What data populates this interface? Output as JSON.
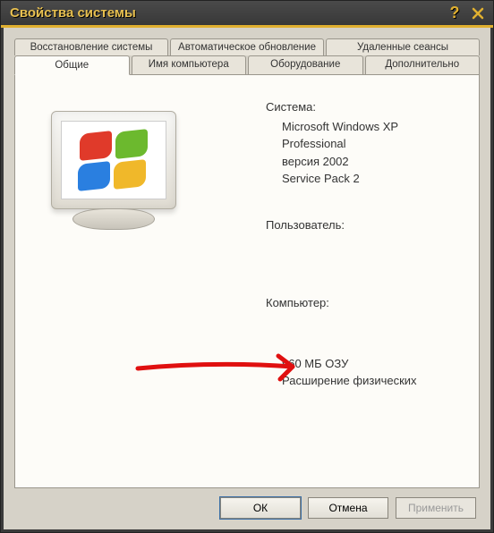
{
  "window": {
    "title": "Свойства системы"
  },
  "tabs": {
    "row1": [
      {
        "label": "Восстановление системы"
      },
      {
        "label": "Автоматическое обновление"
      },
      {
        "label": "Удаленные сеансы"
      }
    ],
    "row2": [
      {
        "label": "Общие"
      },
      {
        "label": "Имя компьютера"
      },
      {
        "label": "Оборудование"
      },
      {
        "label": "Дополнительно"
      }
    ],
    "active": "Общие"
  },
  "system": {
    "heading": "Система:",
    "lines": [
      "Microsoft Windows XP",
      "Professional",
      "версия 2002",
      "Service Pack 2"
    ]
  },
  "user": {
    "heading": "Пользователь:"
  },
  "computer": {
    "heading": "Компьютер:",
    "ram": "960 МБ ОЗУ",
    "ext": "Расширение физических"
  },
  "buttons": {
    "ok": "ОК",
    "cancel": "Отмена",
    "apply": "Применить"
  }
}
